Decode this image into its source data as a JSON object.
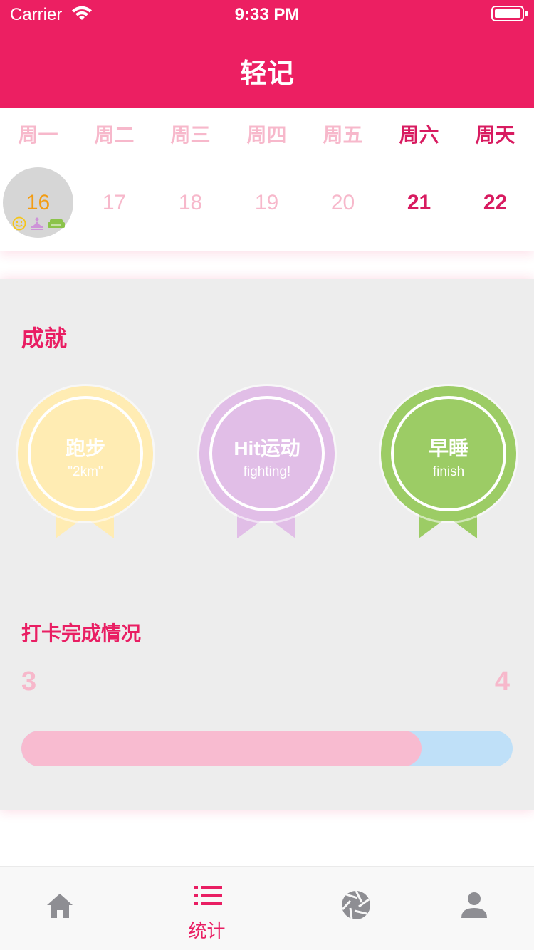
{
  "status_bar": {
    "carrier": "Carrier",
    "time": "9:33 PM"
  },
  "header": {
    "title": "轻记"
  },
  "colors": {
    "brand": "#ec1f62",
    "accent": "#e91e63",
    "weekday_muted": "#f7b8cb"
  },
  "week": {
    "days": [
      {
        "weekday": "周一",
        "date": "16",
        "selected": true,
        "weekend": false
      },
      {
        "weekday": "周二",
        "date": "17",
        "selected": false,
        "weekend": false
      },
      {
        "weekday": "周三",
        "date": "18",
        "selected": false,
        "weekend": false
      },
      {
        "weekday": "周四",
        "date": "19",
        "selected": false,
        "weekend": false
      },
      {
        "weekday": "周五",
        "date": "20",
        "selected": false,
        "weekend": false
      },
      {
        "weekday": "周六",
        "date": "21",
        "selected": false,
        "weekend": true
      },
      {
        "weekday": "周天",
        "date": "22",
        "selected": false,
        "weekend": true
      }
    ],
    "selected_day_icons": [
      "smile-icon",
      "meditation-icon",
      "sofa-icon"
    ]
  },
  "achievements": {
    "title": "成就",
    "medals": [
      {
        "label": "跑步",
        "sub": "\"2km\"",
        "color": "#ffecb3",
        "ring": "#ffecb3"
      },
      {
        "label": "Hit运动",
        "sub": "fighting!",
        "color": "#e1bee7",
        "ring": "#e1bee7"
      },
      {
        "label": "早睡",
        "sub": "finish",
        "color": "#9ccc65",
        "ring": "#9ccc65"
      }
    ]
  },
  "checkin": {
    "title": "打卡完成情况",
    "done": "3",
    "total": "4",
    "progress_fraction": 0.815
  },
  "tabbar": {
    "tabs": [
      {
        "icon": "home-icon",
        "label": "",
        "active": false
      },
      {
        "icon": "list-icon",
        "label": "统计",
        "active": true
      },
      {
        "icon": "aperture-icon",
        "label": "",
        "active": false
      },
      {
        "icon": "person-icon",
        "label": "",
        "active": false
      }
    ]
  }
}
